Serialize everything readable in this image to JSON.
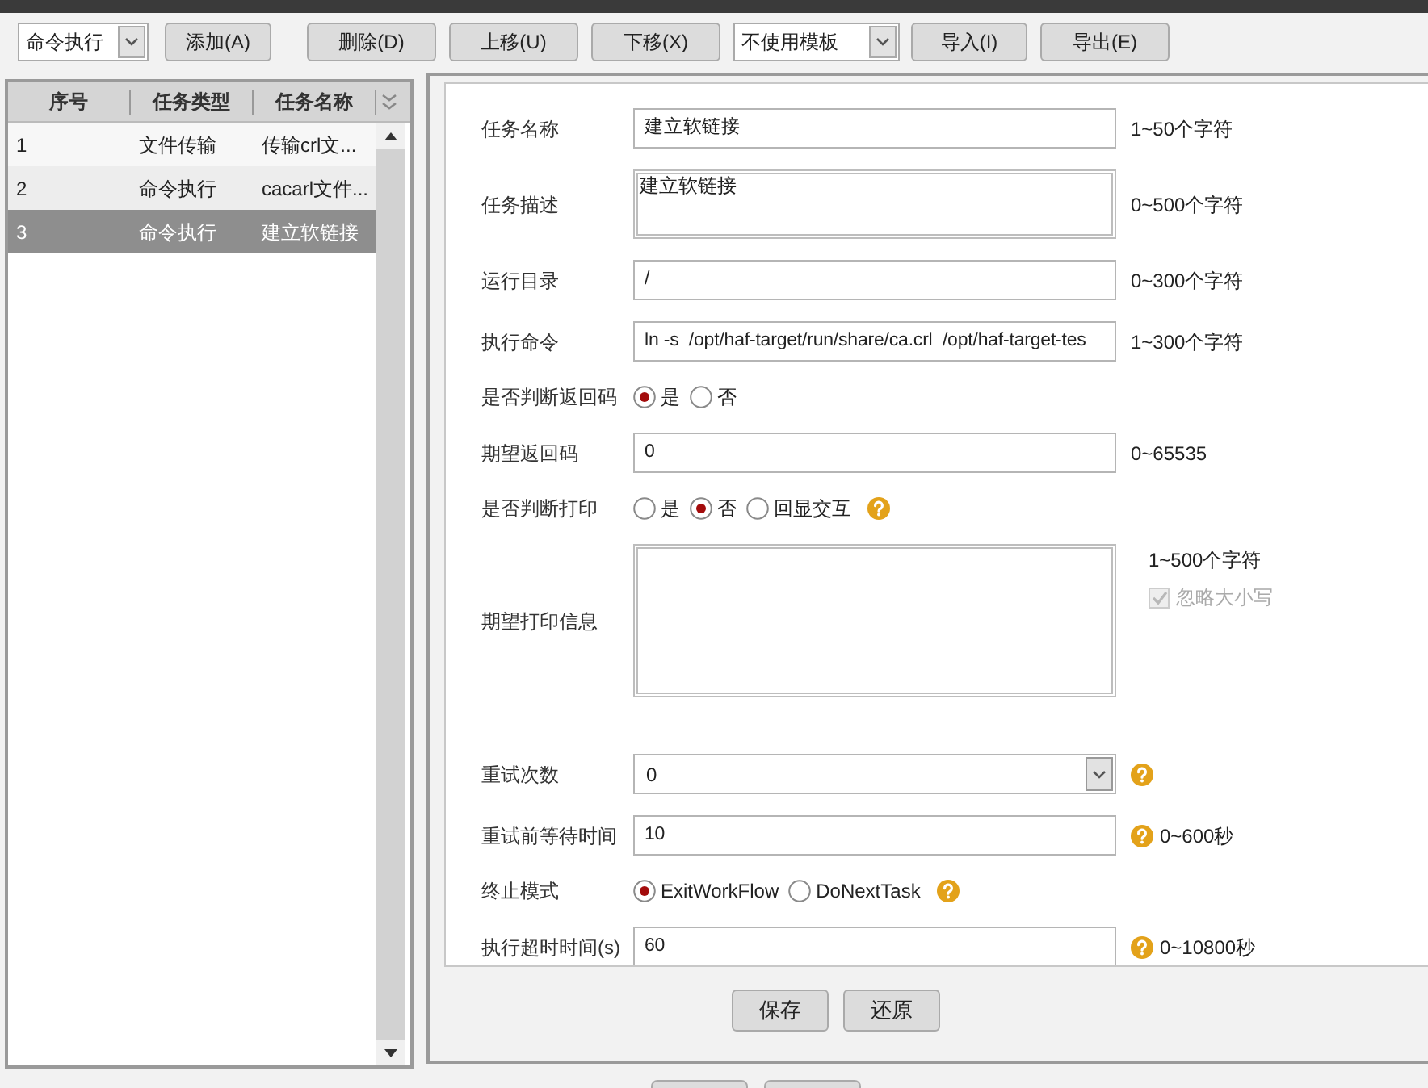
{
  "toolbar": [
    {
      "kind": "select",
      "value": "命令执行"
    },
    {
      "kind": "button",
      "label": "添加(A)"
    },
    {
      "kind": "button",
      "label": "删除(D)"
    },
    {
      "kind": "button",
      "label": "上移(U)"
    },
    {
      "kind": "button",
      "label": "下移(X)"
    },
    {
      "kind": "select",
      "value": "不使用模板"
    },
    {
      "kind": "button",
      "label": "导入(I)"
    },
    {
      "kind": "button",
      "label": "导出(E)"
    }
  ],
  "table": {
    "columns": [
      "序号",
      "任务类型",
      "任务名称"
    ],
    "rows": [
      {
        "cells": [
          "1",
          "文件传输",
          "传输crl文..."
        ],
        "selected": false
      },
      {
        "cells": [
          "2",
          "命令执行",
          "cacarl文件..."
        ],
        "selected": false
      },
      {
        "cells": [
          "3",
          "命令执行",
          "建立软链接"
        ],
        "selected": true
      }
    ]
  },
  "form": {
    "fields": [
      {
        "kind": "text",
        "label": "任务名称",
        "value": "建立软链接",
        "hint": "1~50个字符"
      },
      {
        "kind": "textarea",
        "label": "任务描述",
        "value": "建立软链接",
        "hint": "0~500个字符"
      },
      {
        "kind": "text",
        "label": "运行目录",
        "value": "/",
        "hint": "0~300个字符"
      },
      {
        "kind": "text",
        "label": "执行命令",
        "value": "ln -s  /opt/haf-target/run/share/ca.crl  /opt/haf-target-tes",
        "hint": "1~300个字符"
      },
      {
        "kind": "radio",
        "label": "是否判断返回码",
        "options": [
          {
            "label": "是",
            "selected": true
          },
          {
            "label": "否",
            "selected": false
          }
        ]
      },
      {
        "kind": "text",
        "label": "期望返回码",
        "value": "0",
        "hint": "0~65535"
      },
      {
        "kind": "radio",
        "label": "是否判断打印",
        "options": [
          {
            "label": "是",
            "selected": false
          },
          {
            "label": "否",
            "selected": true
          },
          {
            "label": "回显交互",
            "selected": false
          }
        ],
        "help": true
      },
      {
        "kind": "bigtext",
        "label": "期望打印信息",
        "hint": "1~500个字符",
        "checkbox": {
          "label": "忽略大小写",
          "checked": true,
          "disabled": true
        }
      },
      {
        "kind": "select",
        "label": "重试次数",
        "value": "0",
        "help": true
      },
      {
        "kind": "text",
        "label": "重试前等待时间",
        "value": "10",
        "help": true,
        "hint": "0~600秒"
      },
      {
        "kind": "radio",
        "label": "终止模式",
        "options": [
          {
            "label": "ExitWorkFlow",
            "selected": true
          },
          {
            "label": "DoNextTask",
            "selected": false
          }
        ],
        "help": true
      },
      {
        "kind": "text",
        "label": "执行超时时间(s)",
        "value": "60",
        "help": true,
        "hint": "0~10800秒"
      }
    ]
  },
  "actions": [
    {
      "label": "保存"
    },
    {
      "label": "还原"
    }
  ]
}
